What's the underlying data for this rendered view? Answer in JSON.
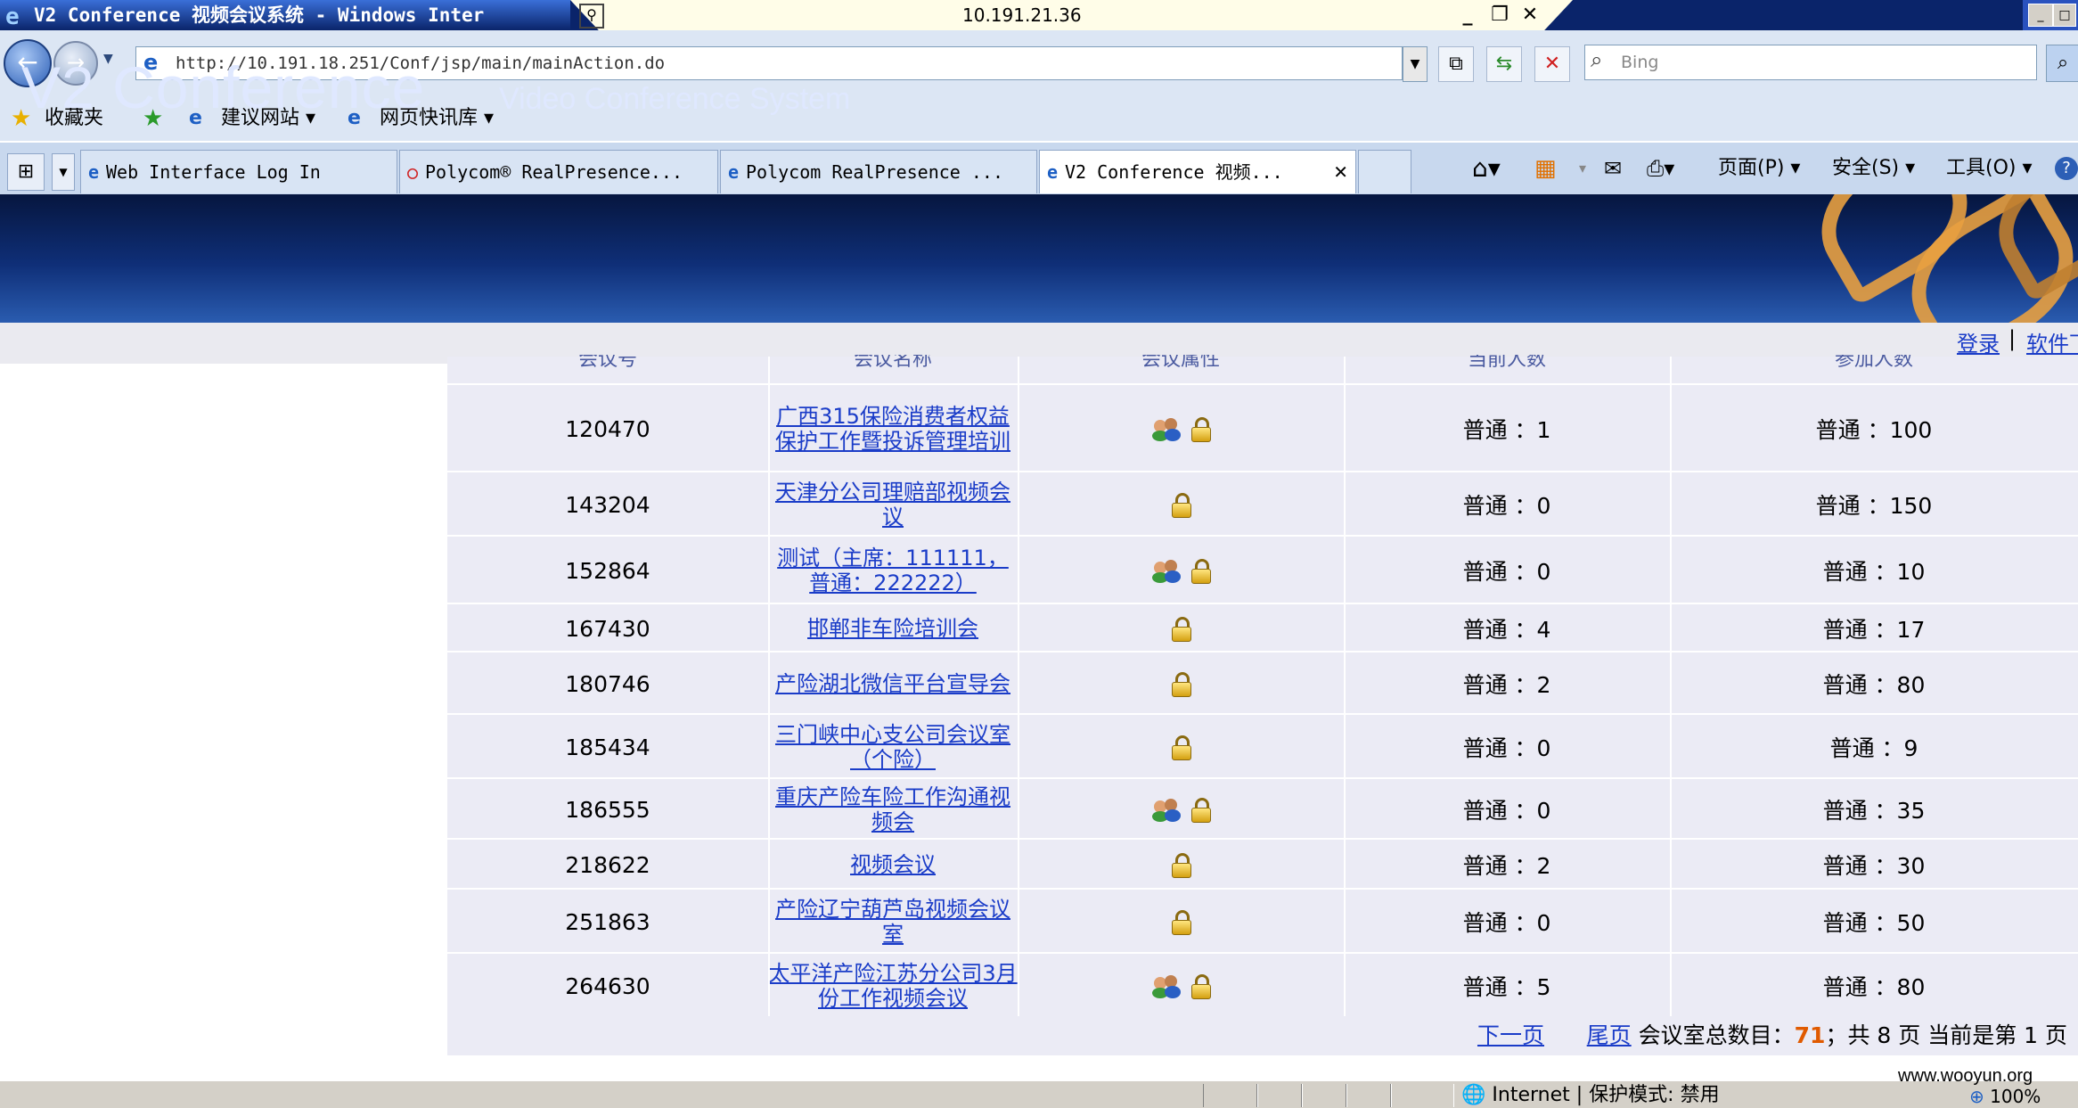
{
  "titlebar": {
    "title": "V2 Conference 视频会议系统 - Windows Inter",
    "remote_host": "10.191.21.36",
    "min": "_",
    "restore": "❐",
    "close": "✕"
  },
  "address": {
    "url": "http://10.191.18.251/Conf/jsp/main/mainAction.do",
    "search_placeholder": "Bing"
  },
  "favorites": {
    "label": "收藏夹",
    "suggested": "建议网站 ▾",
    "webslice": "网页快讯库 ▾"
  },
  "tabs": [
    {
      "label": "Web Interface Log In"
    },
    {
      "label": "Polycom® RealPresence..."
    },
    {
      "label": "Polycom RealPresence ..."
    },
    {
      "label": "V2 Conference 视频..."
    }
  ],
  "commands": {
    "page": "页面(P) ▾",
    "safety": "安全(S) ▾",
    "tools": "工具(O) ▾"
  },
  "banner": {
    "title": "V2 Conference",
    "subtitle": "Video Conference System"
  },
  "topnav": {
    "login": "登录",
    "separator": "|",
    "software": "软件下"
  },
  "table": {
    "headers": [
      "会议号",
      "会议名称",
      "会议属性",
      "当前人数",
      "参加人数"
    ],
    "rows": [
      {
        "id": "120470",
        "name": "广西315保险消费者权益保护工作暨投诉管理培训",
        "group": true,
        "current": "普通 ：1",
        "total": "普通 ：100"
      },
      {
        "id": "143204",
        "name": "天津分公司理赔部视频会议",
        "group": false,
        "current": "普通 ：0",
        "total": "普通 ：150"
      },
      {
        "id": "152864",
        "name": "测试（主席：111111，普通：222222）",
        "group": true,
        "current": "普通 ：0",
        "total": "普通 ：10"
      },
      {
        "id": "167430",
        "name": "邯郸非车险培训会",
        "group": false,
        "current": "普通 ：4",
        "total": "普通 ：17"
      },
      {
        "id": "180746",
        "name": "产险湖北微信平台宣导会",
        "group": false,
        "current": "普通 ：2",
        "total": "普通 ：80"
      },
      {
        "id": "185434",
        "name": "三门峡中心支公司会议室（个险）",
        "group": false,
        "current": "普通 ：0",
        "total": "普通 ：9"
      },
      {
        "id": "186555",
        "name": "重庆产险车险工作沟通视频会",
        "group": true,
        "current": "普通 ：0",
        "total": "普通 ：35"
      },
      {
        "id": "218622",
        "name": "视频会议",
        "group": false,
        "current": "普通 ：2",
        "total": "普通 ：30"
      },
      {
        "id": "251863",
        "name": "产险辽宁葫芦岛视频会议室",
        "group": false,
        "current": "普通 ：0",
        "total": "普通 ：50"
      },
      {
        "id": "264630",
        "name": "太平洋产险江苏分公司3月份工作视频会议",
        "group": true,
        "current": "普通 ：5",
        "total": "普通 ：80"
      }
    ]
  },
  "pager": {
    "next": "下一页",
    "last": "尾页",
    "total_label": "会议室总数目：",
    "total": "71",
    "pages_label": "；共 8 页 当前是第 1 页"
  },
  "status": {
    "zone": "Internet | 保护模式: 禁用",
    "zoom": "100%"
  },
  "watermark": "www.wooyun.org",
  "colors": {
    "link": "#1a3cc8",
    "banner": "#0f2f78",
    "row_bg": "#ebebf5",
    "accent_count": "#e05a00"
  }
}
